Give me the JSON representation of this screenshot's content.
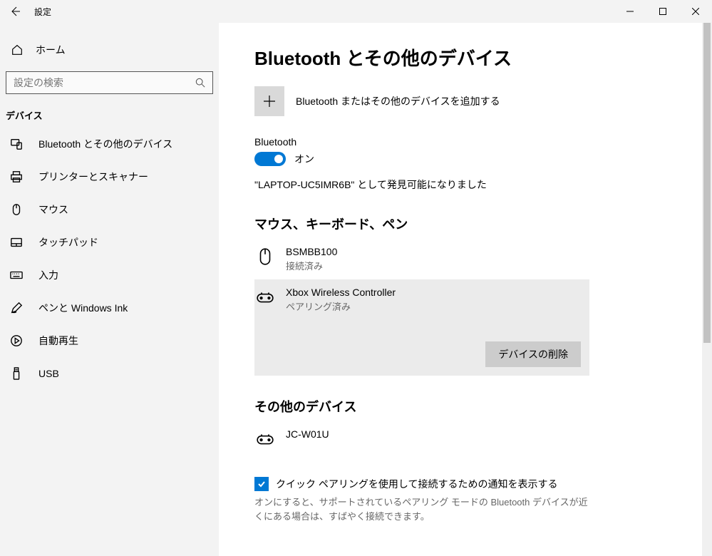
{
  "window": {
    "title": "設定"
  },
  "sidebar": {
    "home": "ホーム",
    "search_placeholder": "設定の検索",
    "category": "デバイス",
    "items": [
      {
        "label": "Bluetooth とその他のデバイス"
      },
      {
        "label": "プリンターとスキャナー"
      },
      {
        "label": "マウス"
      },
      {
        "label": "タッチパッド"
      },
      {
        "label": "入力"
      },
      {
        "label": "ペンと Windows Ink"
      },
      {
        "label": "自動再生"
      },
      {
        "label": "USB"
      }
    ]
  },
  "page": {
    "title": "Bluetooth とその他のデバイス",
    "add_label": "Bluetooth またはその他のデバイスを追加する",
    "bt_label": "Bluetooth",
    "bt_state": "オン",
    "discoverable": "\"LAPTOP-UC5IMR6B\" として発見可能になりました",
    "group1_title": "マウス、キーボード、ペン",
    "dev1_name": "BSMBB100",
    "dev1_status": "接続済み",
    "dev2_name": "Xbox Wireless Controller",
    "dev2_status": "ペアリング済み",
    "remove_label": "デバイスの削除",
    "group2_title": "その他のデバイス",
    "dev3_name": "JC-W01U",
    "quickpair_label": "クイック ペアリングを使用して接続するための通知を表示する",
    "quickpair_help": "オンにすると、サポートされているペアリング モードの Bluetooth デバイスが近くにある場合は、すばやく接続できます。"
  }
}
